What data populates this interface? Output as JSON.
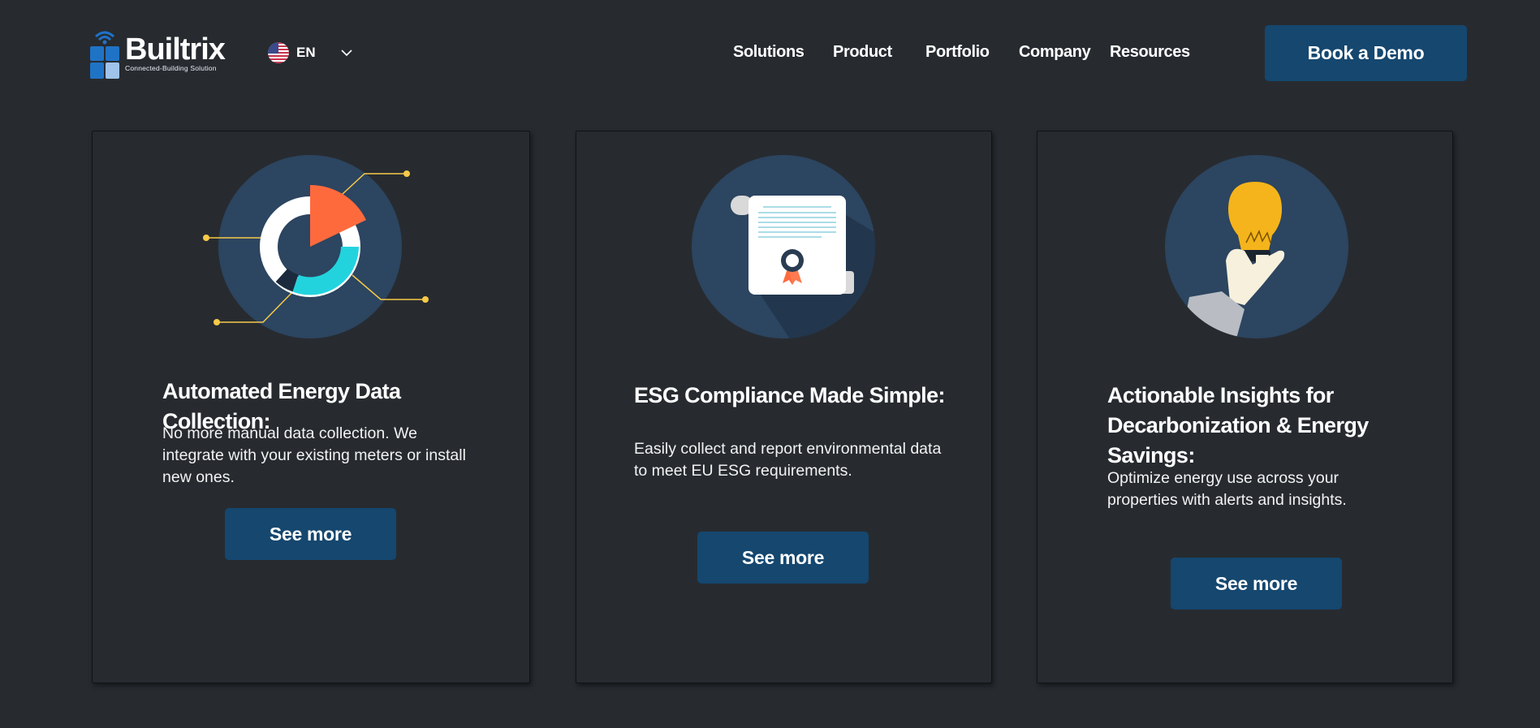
{
  "header": {
    "logo": {
      "name": "Builtrix",
      "tagline": "Connected-Building Solution",
      "icon": "building-wifi-icon"
    },
    "language": {
      "code": "EN",
      "flag_icon": "us-flag-icon"
    },
    "nav": [
      "Solutions",
      "Product",
      "Portfolio",
      "Company",
      "Resources"
    ],
    "cta_label": "Book a Demo"
  },
  "cards": [
    {
      "icon": "energy-donut-chart-icon",
      "title": "Automated Energy Data Collection:",
      "description": "No more manual data collection. We integrate with your existing meters or install new ones.",
      "button_label": "See more"
    },
    {
      "icon": "certificate-scroll-icon",
      "title": "ESG Compliance Made Simple:",
      "description": "Easily collect and report environmental data to meet EU ESG requirements.",
      "button_label": "See more"
    },
    {
      "icon": "lightbulb-hand-icon",
      "title": "Actionable Insights for Decarbonization & Energy Savings:",
      "description": "Optimize energy use across your properties with alerts and insights.",
      "button_label": "See more"
    }
  ],
  "colors": {
    "background": "#272b30",
    "button": "#15476f",
    "circle": "#2c4560",
    "accent_orange": "#ff6a3d",
    "accent_cyan": "#22d3de",
    "accent_yellow": "#f7c948",
    "bulb_yellow": "#f5b41b"
  }
}
